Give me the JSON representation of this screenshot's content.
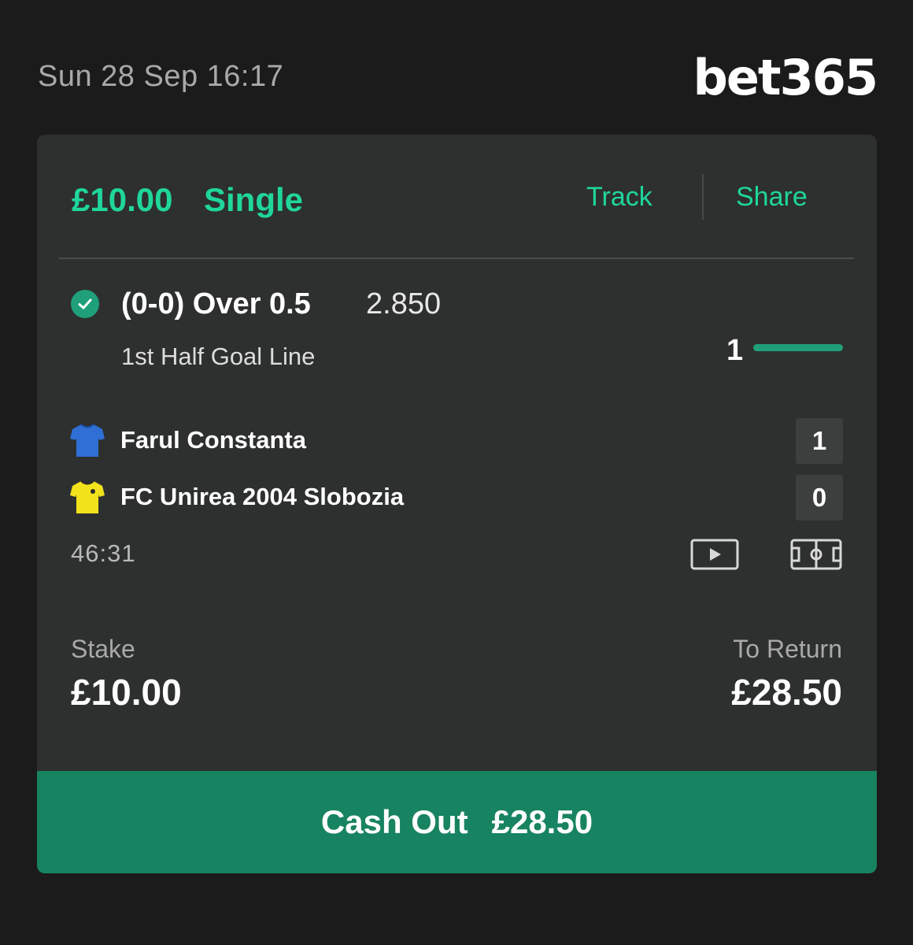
{
  "header": {
    "datetime": "Sun 28 Sep 16:17",
    "brand": "bet365"
  },
  "bet": {
    "amount": "£10.00",
    "type": "Single",
    "track_label": "Track",
    "share_label": "Share"
  },
  "selection": {
    "name": "(0-0) Over 0.5",
    "odds": "2.850",
    "market": "1st Half Goal Line",
    "goals_count": "1",
    "status_icon": "check-circle-icon"
  },
  "match": {
    "home_team": "Farul Constanta",
    "home_score": "1",
    "home_shirt_color": "#2f6fd6",
    "away_team": "FC Unirea 2004 Slobozia",
    "away_score": "0",
    "away_shirt_color": "#f2e21c",
    "clock": "46:31"
  },
  "totals": {
    "stake_label": "Stake",
    "stake_value": "£10.00",
    "return_label": "To Return",
    "return_value": "£28.50"
  },
  "cashout": {
    "label": "Cash Out",
    "amount": "£28.50"
  },
  "colors": {
    "accent": "#1fd69b",
    "cashout_bg": "#188361",
    "card_bg": "#2d302f",
    "page_bg": "#1b1b1b"
  }
}
